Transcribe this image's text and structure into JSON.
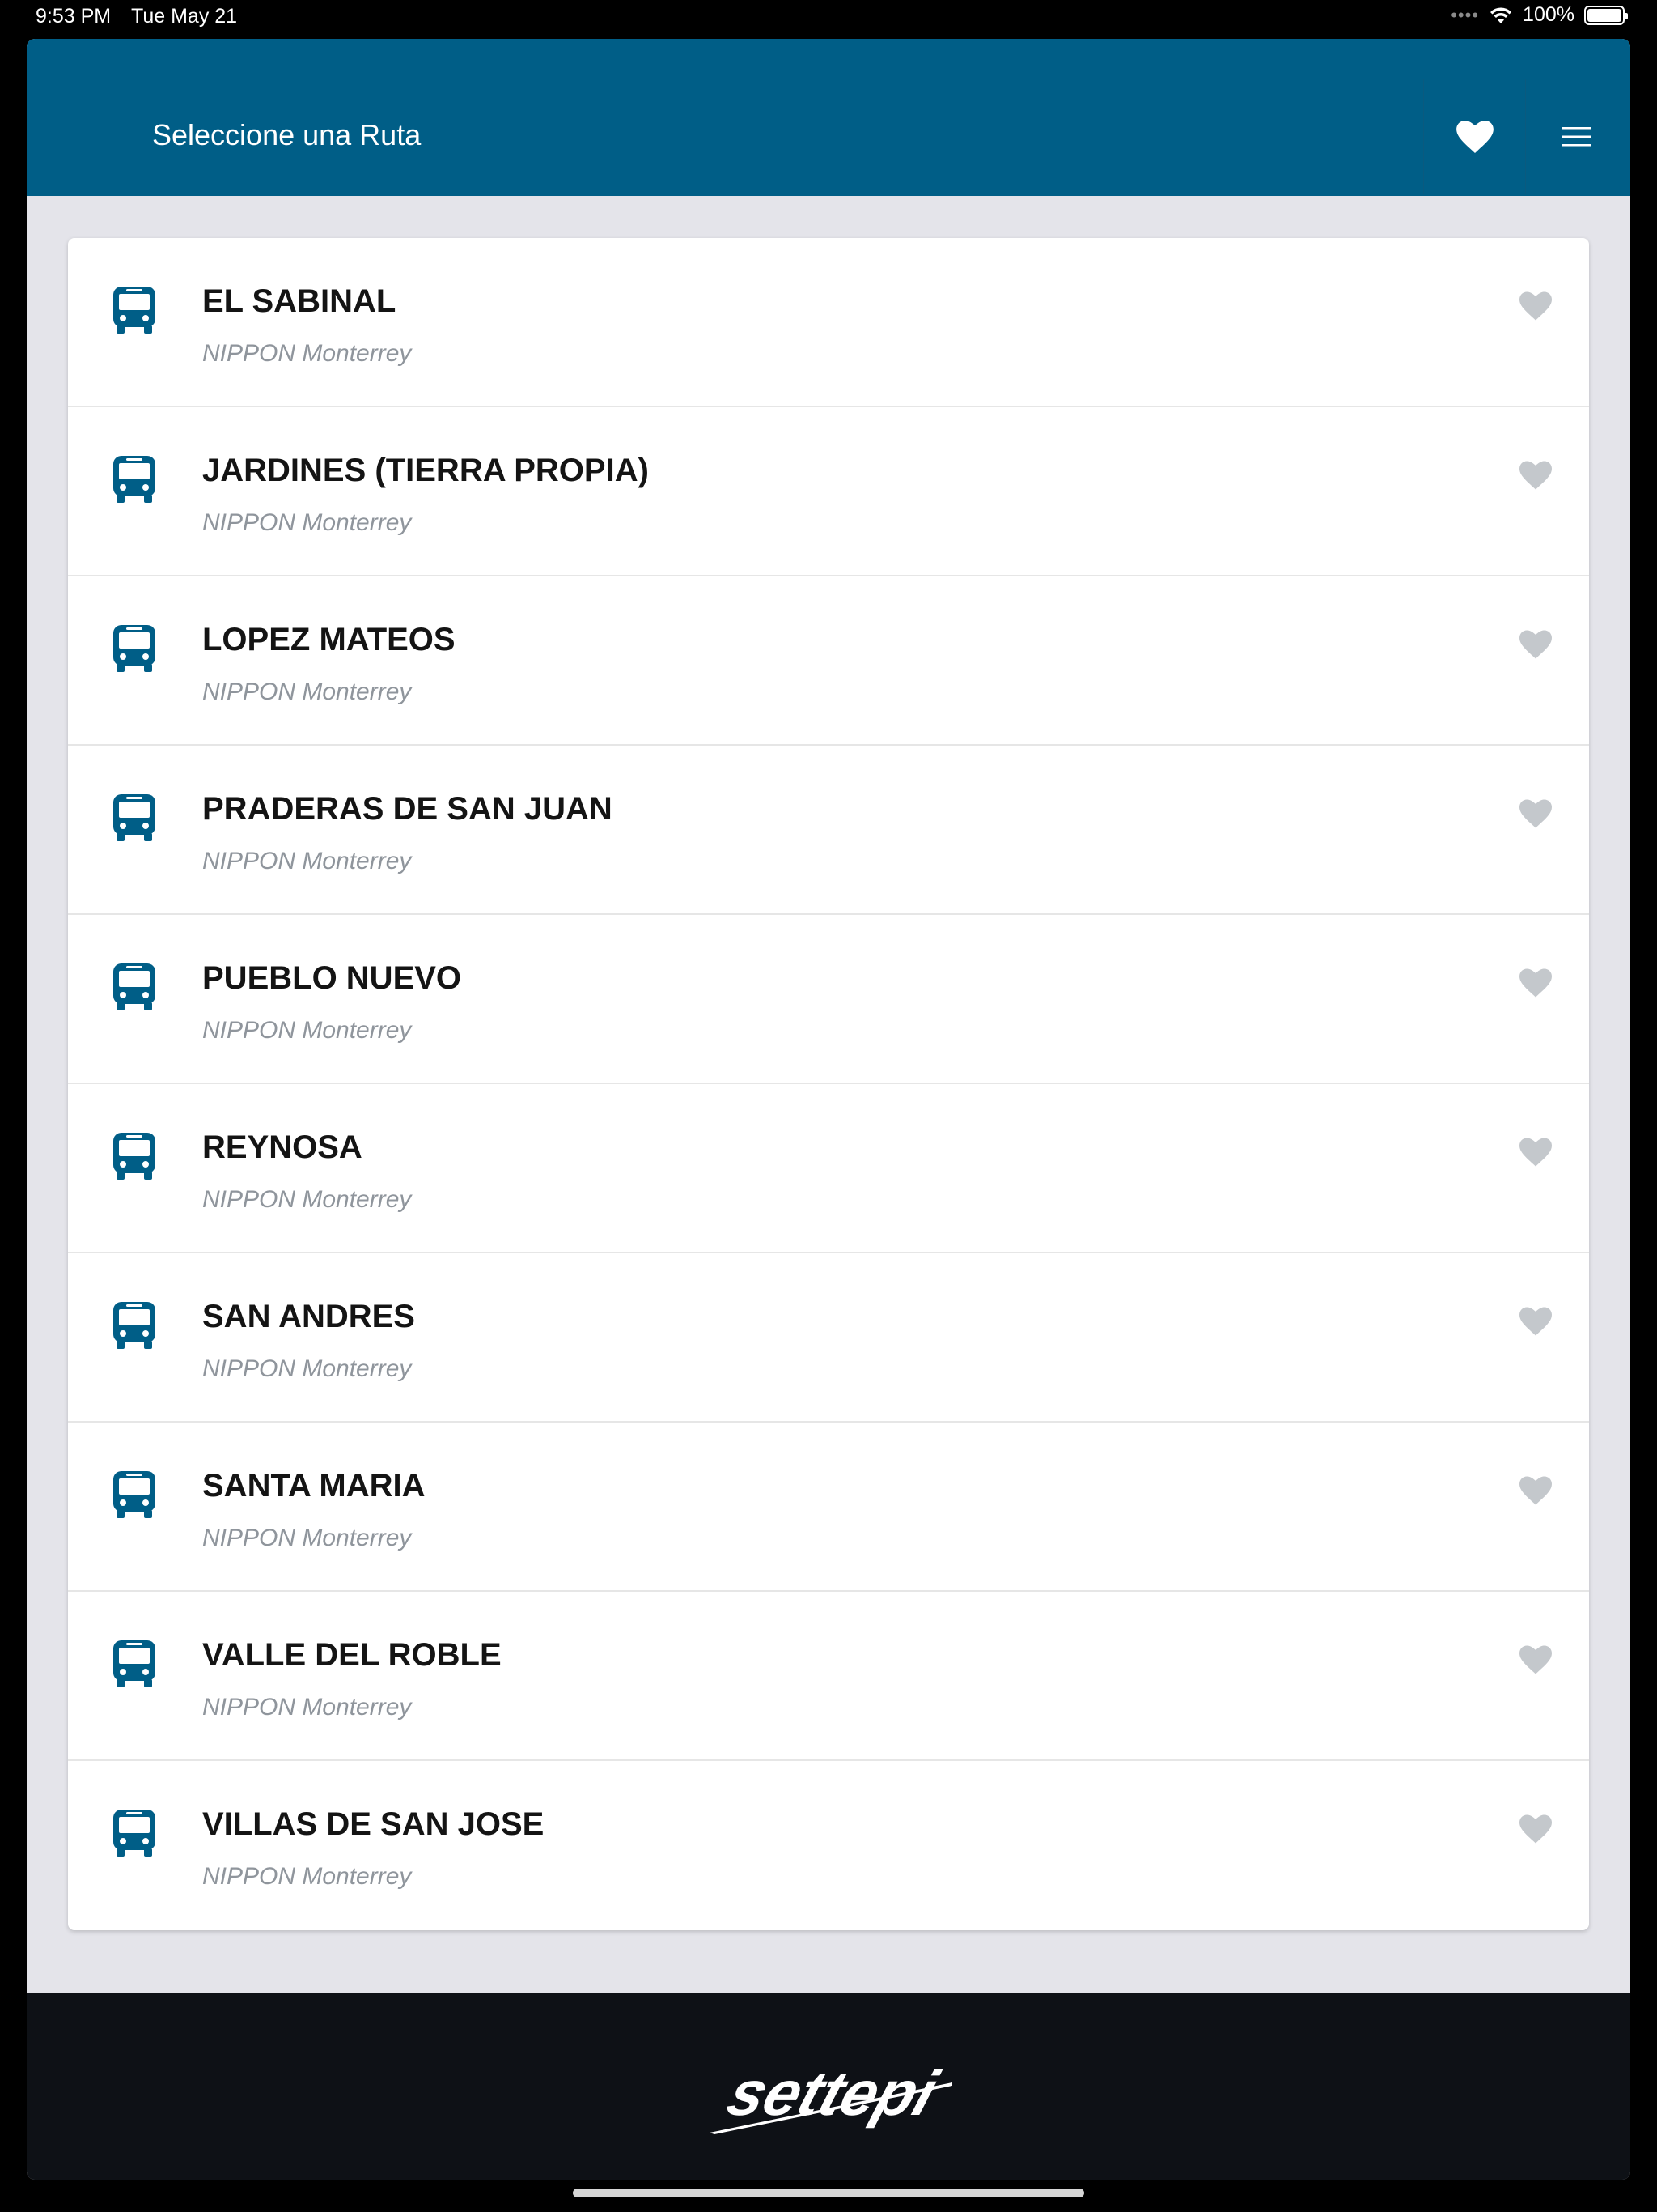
{
  "status_bar": {
    "time": "9:53 PM",
    "date": "Tue May 21",
    "battery": "100%"
  },
  "header": {
    "title": "Seleccione una Ruta",
    "favorites_icon": "heart-icon",
    "menu_icon": "hamburger-menu-icon"
  },
  "routes": [
    {
      "name": "EL SABINAL",
      "company": "NIPPON Monterrey"
    },
    {
      "name": "JARDINES (TIERRA PROPIA)",
      "company": "NIPPON Monterrey"
    },
    {
      "name": "LOPEZ MATEOS",
      "company": "NIPPON Monterrey"
    },
    {
      "name": "PRADERAS DE SAN JUAN",
      "company": "NIPPON Monterrey"
    },
    {
      "name": "PUEBLO NUEVO",
      "company": "NIPPON Monterrey"
    },
    {
      "name": "REYNOSA",
      "company": "NIPPON Monterrey"
    },
    {
      "name": "SAN ANDRES",
      "company": "NIPPON Monterrey"
    },
    {
      "name": "SANTA MARIA",
      "company": "NIPPON Monterrey"
    },
    {
      "name": "VALLE DEL ROBLE",
      "company": "NIPPON Monterrey"
    },
    {
      "name": "VILLAS DE SAN JOSE",
      "company": "NIPPON Monterrey"
    }
  ],
  "footer": {
    "logo_text": "settepi"
  },
  "colors": {
    "header": "#005e87",
    "bus_icon": "#005e87",
    "heart_inactive": "#c4c8cc",
    "footer": "#0e1116"
  }
}
